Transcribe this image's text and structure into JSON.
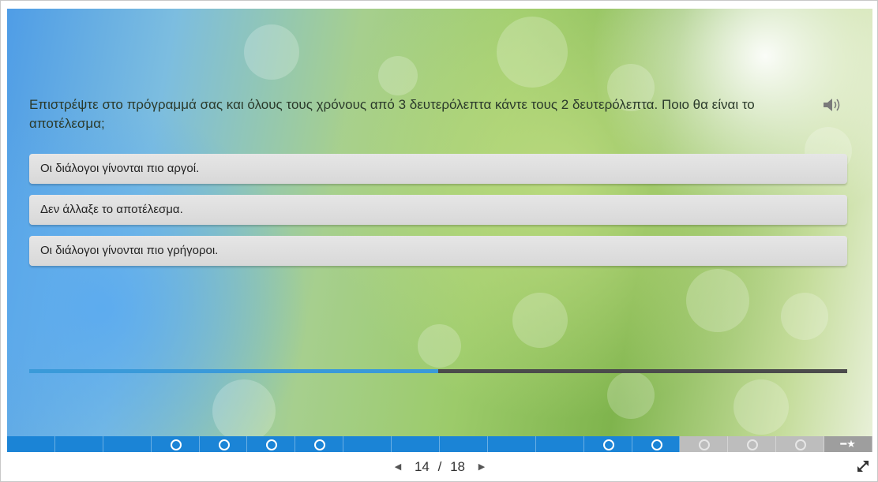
{
  "question": {
    "text": "Επιστρέψτε στο πρόγραμμά σας και όλους τους χρόνους από 3 δευτερόλεπτα κάντε τους 2 δευτερόλεπτα. Ποιο θα είναι το αποτέλεσμα;"
  },
  "icons": {
    "audio": "speaker-icon",
    "prev": "triangle-left-icon",
    "next": "triangle-right-icon",
    "fullscreen": "expand-icon",
    "star": "star-icon"
  },
  "answers": [
    {
      "label": "Οι διάλογοι γίνονται πιο αργοί."
    },
    {
      "label": "Δεν άλλαξε το αποτέλεσμα."
    },
    {
      "label": "Οι διάλογοι γίνονται πιο γρήγοροι."
    }
  ],
  "progress": {
    "fraction": 0.5
  },
  "navbar": {
    "segments": [
      {
        "state": "visited",
        "dot": false
      },
      {
        "state": "visited",
        "dot": false
      },
      {
        "state": "visited",
        "dot": false
      },
      {
        "state": "visited",
        "dot": true
      },
      {
        "state": "visited",
        "dot": true
      },
      {
        "state": "visited",
        "dot": true
      },
      {
        "state": "visited",
        "dot": true
      },
      {
        "state": "visited",
        "dot": false
      },
      {
        "state": "visited",
        "dot": false
      },
      {
        "state": "visited",
        "dot": false
      },
      {
        "state": "visited",
        "dot": false
      },
      {
        "state": "visited",
        "dot": false
      },
      {
        "state": "visited",
        "dot": true
      },
      {
        "state": "visited",
        "dot": true
      },
      {
        "state": "unvisited",
        "dot": true
      },
      {
        "state": "unvisited",
        "dot": true
      },
      {
        "state": "unvisited",
        "dot": true
      },
      {
        "state": "last",
        "dot": false,
        "star": true
      }
    ],
    "colors": {
      "visited": "#1b84d6",
      "unvisited": "#bdbdbd"
    }
  },
  "pager": {
    "current": "14",
    "separator": "/",
    "total": "18"
  }
}
